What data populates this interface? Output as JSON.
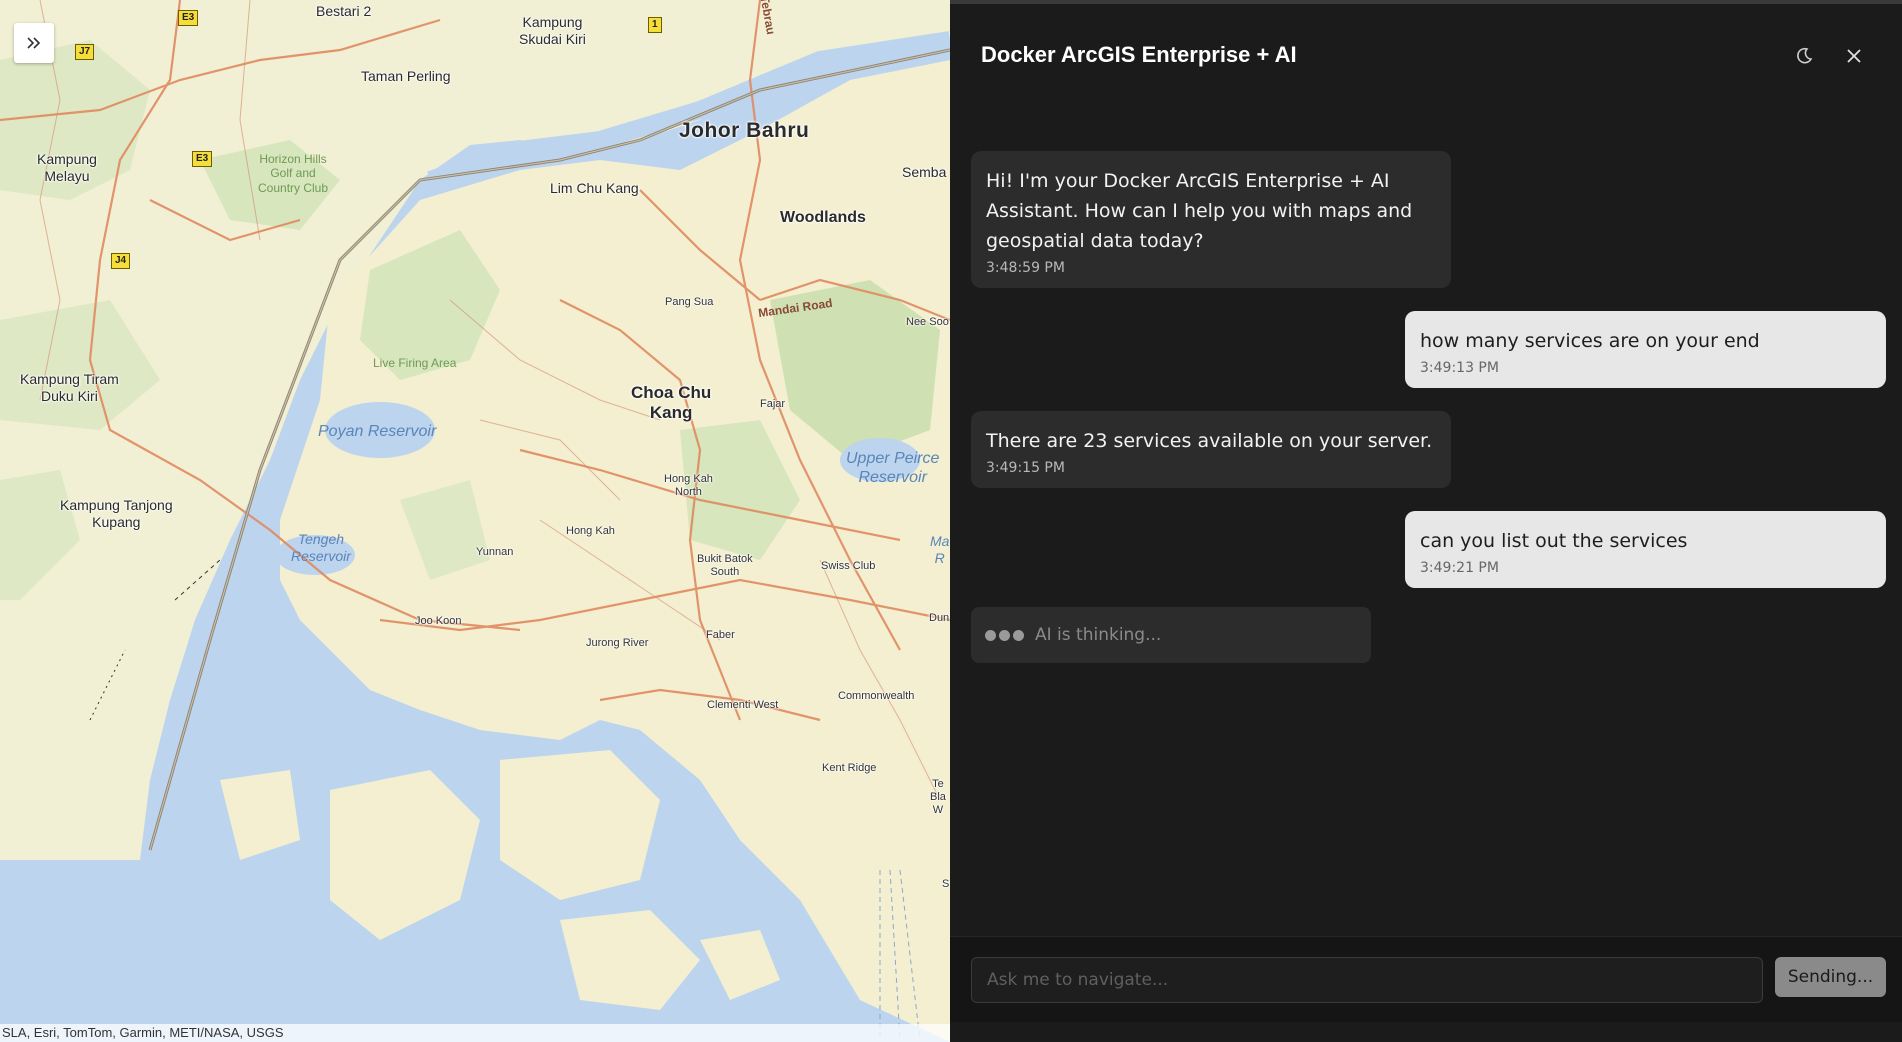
{
  "map": {
    "expand_icon": "double-chevron-right-icon",
    "labels": {
      "bestari": "Bestari 2",
      "kampung_skudai": "Kampung\nSkudai Kiri",
      "taman_perling": "Taman Perling",
      "johor_bahru": "Johor Bahru",
      "kampung_melayu": "Kampung\nMelayu",
      "horizon_hills": "Horizon Hills\nGolf and\nCountry Club",
      "lim_chu_kang": "Lim Chu Kang",
      "woodlands": "Woodlands",
      "semba": "Semba",
      "pang_sua": "Pang Sua",
      "mandai_road": "Mandai Road",
      "nee_soo": "Nee Soo",
      "live_firing": "Live Firing Area",
      "kampung_tiram": "Kampung Tiram\nDuku Kiri",
      "choa_chu_kang": "Choa Chu\nKang",
      "fajar": "Fajar",
      "poyan": "Poyan Reservoir",
      "upper_peirce": "Upper Peirce\nReservoir",
      "kampung_tanjong": "Kampung Tanjong\nKupang",
      "hong_kah_north": "Hong Kah\nNorth",
      "tengeh": "Tengeh\nReservoir",
      "hong_kah": "Hong Kah",
      "yunnan": "Yunnan",
      "bukit_batok": "Bukit Batok\nSouth",
      "swiss_club": "Swiss Club",
      "joo_koon": "Joo Koon",
      "jurong_river": "Jurong River",
      "faber": "Faber",
      "clementi": "Clementi West",
      "commonwealth": "Commonwealth",
      "kent_ridge": "Kent Ridge",
      "tebrau": "Tebrau",
      "ma_r": "Ma\nR",
      "dun": "Dun",
      "s": "S",
      "te_bla": "Te\nBla\nW"
    },
    "shields": {
      "e3_top": "E3",
      "j7": "J7",
      "e3_mid": "E3",
      "j4": "J4",
      "one": "1"
    },
    "attribution": "SLA, Esri, TomTom, Garmin, METI/NASA, USGS"
  },
  "chat": {
    "title": "Docker ArcGIS Enterprise + AI",
    "theme_icon": "moon-icon",
    "close_icon": "close-icon",
    "messages": [
      {
        "role": "ai",
        "text": "Hi! I'm your Docker ArcGIS Enterprise + AI Assistant. How can I help you with maps and geospatial data today?",
        "time": "3:48:59 PM"
      },
      {
        "role": "user",
        "text": "how many services are on your end",
        "time": "3:49:13 PM"
      },
      {
        "role": "ai",
        "text": "There are 23 services available on your server.",
        "time": "3:49:15 PM"
      },
      {
        "role": "user",
        "text": "can you list out the services",
        "time": "3:49:21 PM"
      }
    ],
    "thinking": "AI is thinking...",
    "input": {
      "placeholder": "Ask me to navigate...",
      "value": ""
    },
    "send_label": "Sending..."
  }
}
